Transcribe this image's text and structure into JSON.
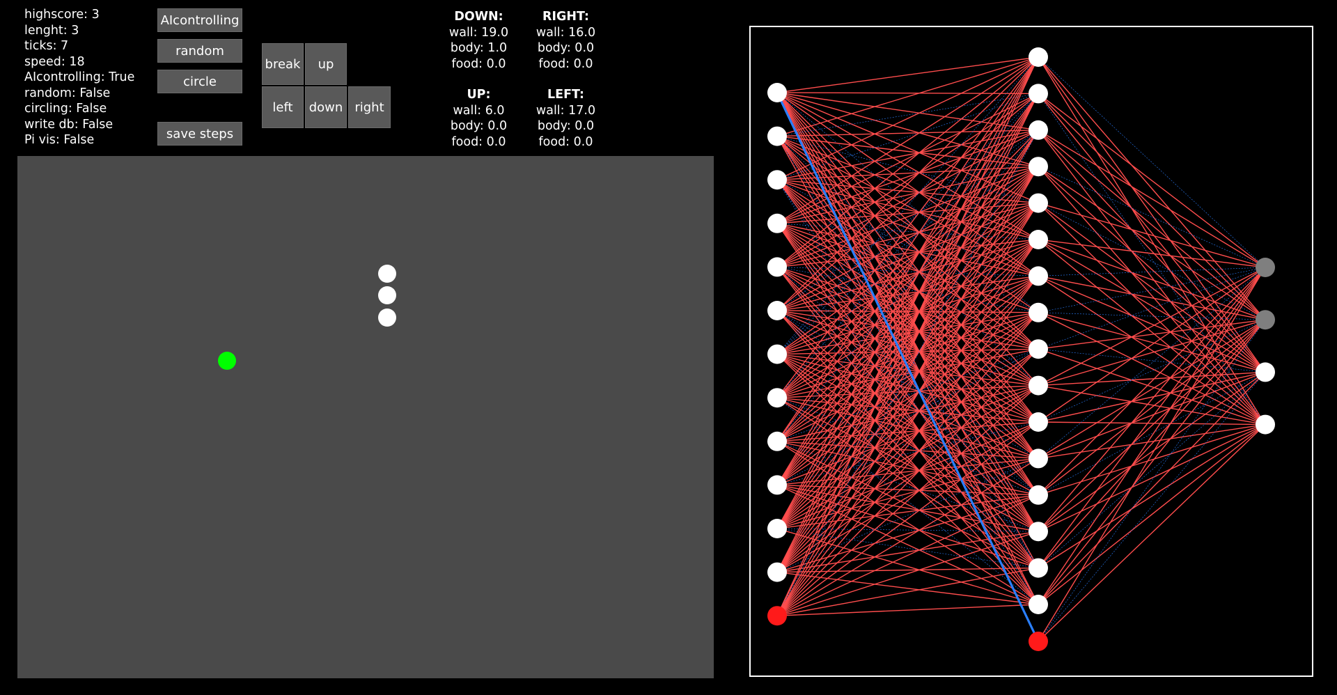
{
  "stats": [
    "highscore: 3",
    "lenght: 3",
    "ticks: 7",
    "speed: 18",
    "AIcontrolling: True",
    "random: False",
    "circling: False",
    "write db: False",
    "Pi vis: False"
  ],
  "buttons": {
    "aicontrolling": "AIcontrolling",
    "random": "random",
    "circle": "circle",
    "save_steps": "save steps",
    "break": "break",
    "up": "up",
    "left": "left",
    "down": "down",
    "right": "right"
  },
  "sensors": {
    "down": {
      "title": "DOWN:",
      "wall": "wall: 19.0",
      "body": "body: 1.0",
      "food": "food: 0.0"
    },
    "right": {
      "title": "RIGHT:",
      "wall": "wall: 16.0",
      "body": "body: 0.0",
      "food": "food: 0.0"
    },
    "up": {
      "title": "UP:",
      "wall": "wall: 6.0",
      "body": "body: 0.0",
      "food": "food: 0.0"
    },
    "left": {
      "title": "LEFT:",
      "wall": "wall: 17.0",
      "body": "body: 0.0",
      "food": "food: 0.0"
    }
  },
  "colors": {
    "board": "#4a4a4a",
    "snake": "#ffffff",
    "food": "#00ff00",
    "neuron": "#ffffff",
    "bias_neuron": "#ff1a1a",
    "inactive_output": "#7f7f7f",
    "positive_weight": "#ff4d4d",
    "negative_weight": "#2a7fff"
  },
  "network": {
    "layers": [
      13,
      17,
      4
    ],
    "bias_in_layer": [
      true,
      true,
      false
    ],
    "output_active": [
      false,
      false,
      true,
      true
    ]
  }
}
